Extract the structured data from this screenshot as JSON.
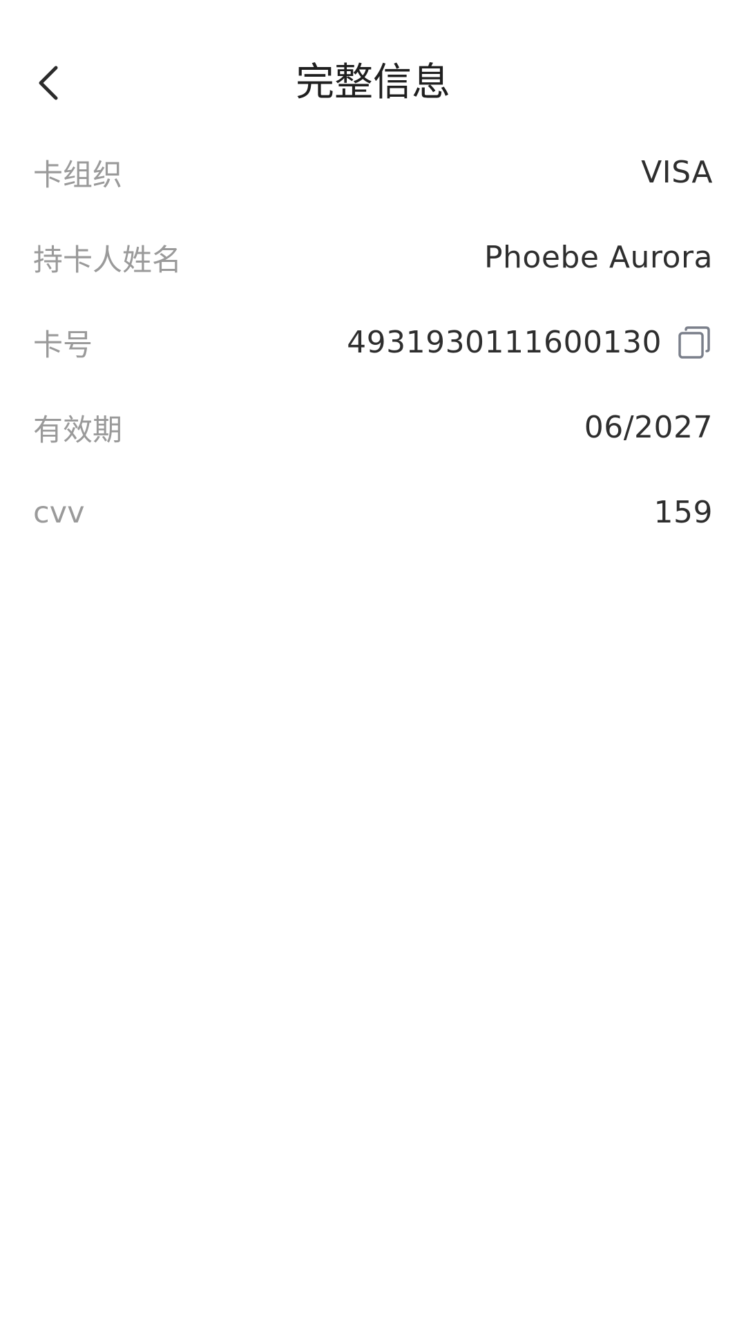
{
  "header": {
    "title": "完整信息",
    "back_icon": "chevron-left-icon"
  },
  "rows": [
    {
      "label": "卡组织",
      "value": "VISA"
    },
    {
      "label": "持卡人姓名",
      "value": "Phoebe Aurora"
    },
    {
      "label": "卡号",
      "value": "4931930111600130",
      "action_icon": "copy-icon"
    },
    {
      "label": "有效期",
      "value": "06/2027"
    },
    {
      "label": "cvv",
      "value": "159"
    }
  ],
  "colors": {
    "label": "#9a9a9a",
    "value": "#2e2e2e",
    "title": "#1f1f1f",
    "icon": "#7a7f8a"
  }
}
